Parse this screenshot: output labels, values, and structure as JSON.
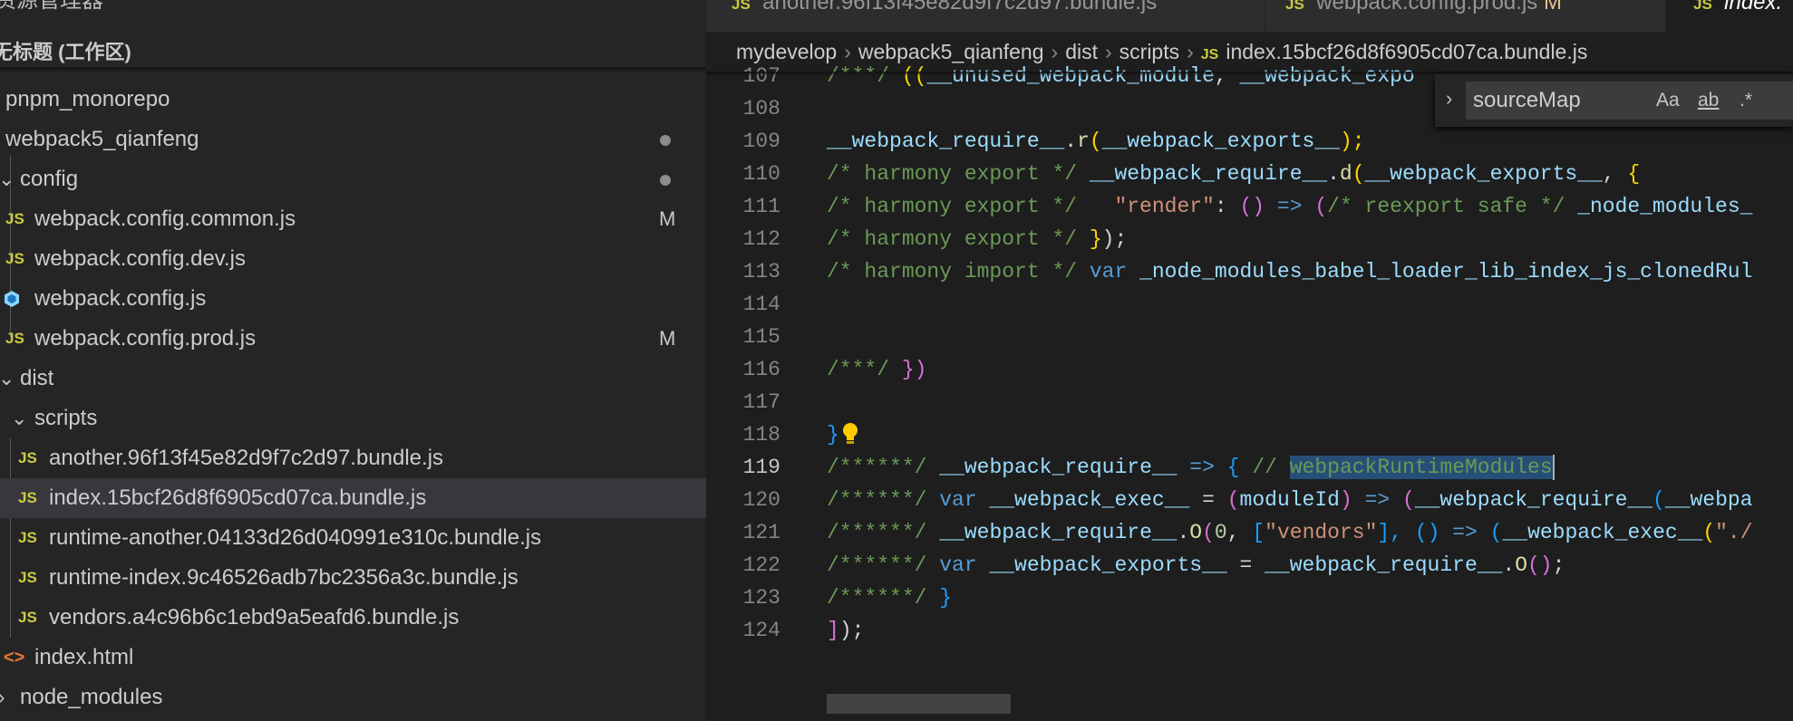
{
  "sidebar": {
    "header_title": "资源管理器",
    "header_more": "···",
    "workspace": "无标题 (工作区)",
    "items": [
      {
        "label": "pnpm_monorepo"
      },
      {
        "label": "webpack5_qianfeng"
      },
      {
        "label": "config"
      },
      {
        "label": "webpack.config.common.js",
        "badge": "M"
      },
      {
        "label": "webpack.config.dev.js"
      },
      {
        "label": "webpack.config.js"
      },
      {
        "label": "webpack.config.prod.js",
        "badge": "M"
      },
      {
        "label": "dist"
      },
      {
        "label": "scripts"
      },
      {
        "label": "another.96f13f45e82d9f7c2d97.bundle.js"
      },
      {
        "label": "index.15bcf26d8f6905cd07ca.bundle.js"
      },
      {
        "label": "runtime-another.04133d26d040991e310c.bundle.js"
      },
      {
        "label": "runtime-index.9c46526adb7bc2356a3c.bundle.js"
      },
      {
        "label": "vendors.a4c96b6c1ebd9a5eafd6.bundle.js"
      },
      {
        "label": "index.html"
      },
      {
        "label": "node_modules"
      }
    ],
    "js_icon_text": "JS",
    "html_icon_text": "<>"
  },
  "tabs": [
    {
      "label": "another.96f13f45e82d9f7c2d97.bundle.js"
    },
    {
      "label": "webpack.config.prod.js",
      "badge": "M"
    },
    {
      "label": "index."
    }
  ],
  "breadcrumb": [
    "mydevelop",
    "webpack5_qianfeng",
    "dist",
    "scripts",
    "index.15bcf26d8f6905cd07ca.bundle.js"
  ],
  "find": {
    "value": "sourceMap",
    "opt_case": "Aa",
    "opt_word": "ab",
    "opt_regex": ".*"
  },
  "code": {
    "line_numbers": [
      "107",
      "108",
      "109",
      "110",
      "111",
      "112",
      "113",
      "114",
      "115",
      "116",
      "117",
      "118",
      "119",
      "120",
      "121",
      "122",
      "123",
      "124"
    ],
    "current_line": "119",
    "l107": [
      "/***/ ",
      "((",
      "__unused_webpack_module",
      ", ",
      "__webpack_expo"
    ],
    "l109": [
      "__webpack_require__",
      ".",
      "r",
      "(",
      "__webpack_exports__",
      ");"
    ],
    "l110": [
      "/* harmony export */ ",
      "__webpack_require__",
      ".",
      "d",
      "(",
      "__webpack_exports__",
      ", ",
      "{"
    ],
    "l111": [
      "/* harmony export */   ",
      "\"render\"",
      ": ",
      "() ",
      "=> ",
      "(",
      "/* reexport safe */ ",
      "_node_modules_"
    ],
    "l112": [
      "/* harmony export */ ",
      "}",
      ");"
    ],
    "l113": [
      "/* harmony import */ ",
      "var ",
      "_node_modules_babel_loader_lib_index_js_clonedRul"
    ],
    "l116": [
      "/***/ ",
      "})"
    ],
    "l118": [
      "}"
    ],
    "l119": [
      "/******/ ",
      "__webpack_require__",
      " => ",
      "{ ",
      "// ",
      "webpackRuntimeModules"
    ],
    "l120": [
      "/******/ ",
      "var ",
      "__webpack_exec__",
      " = ",
      "(",
      "moduleId",
      ") ",
      "=> ",
      "(",
      "__webpack_require__",
      "(",
      "__webpa"
    ],
    "l121": [
      "/******/ ",
      "__webpack_require__",
      ".",
      "O",
      "(",
      "0",
      ", ",
      "[",
      "\"vendors\"",
      "], ",
      "() ",
      "=> ",
      "(",
      "__webpack_exec__",
      "(",
      "\"./"
    ],
    "l122": [
      "/******/ ",
      "var ",
      "__webpack_exports__",
      " = ",
      "__webpack_require__",
      ".",
      "O",
      "()",
      ";"
    ],
    "l123": [
      "/******/ ",
      "}"
    ],
    "l124": [
      "]",
      ");"
    ]
  }
}
